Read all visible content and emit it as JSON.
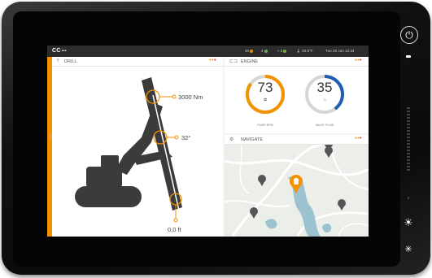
{
  "status_bar": {
    "logo": "CC",
    "logo_dots": "•••",
    "item1": "40",
    "item2": "4",
    "item3": "3",
    "temp": "33.8°F",
    "datetime": "Tue 20 Jun  12:34"
  },
  "drill_panel": {
    "title": "DRILL",
    "menu": "•••",
    "torque": "3000 Nm",
    "angle": "32°",
    "depth": "0,0 ft"
  },
  "engine_panel": {
    "title": "ENGINE",
    "menu": "•••",
    "gauges": [
      {
        "value": "73",
        "label": "PUMP RPM",
        "fraction": 0.85,
        "color": "#f39200"
      },
      {
        "value": "35",
        "label": "VALVE FLOW",
        "fraction": 0.4,
        "color": "#1e5fb0"
      }
    ]
  },
  "navigate_panel": {
    "title": "NAVIGATE",
    "menu": "•••"
  },
  "side_buttons": {
    "power": "⏻",
    "brightness_up": "☀",
    "brightness_down": "✳"
  },
  "colors": {
    "accent": "#f39200",
    "bezel": "#111111",
    "map_water": "#9bc3cf",
    "pin": "#555555"
  }
}
